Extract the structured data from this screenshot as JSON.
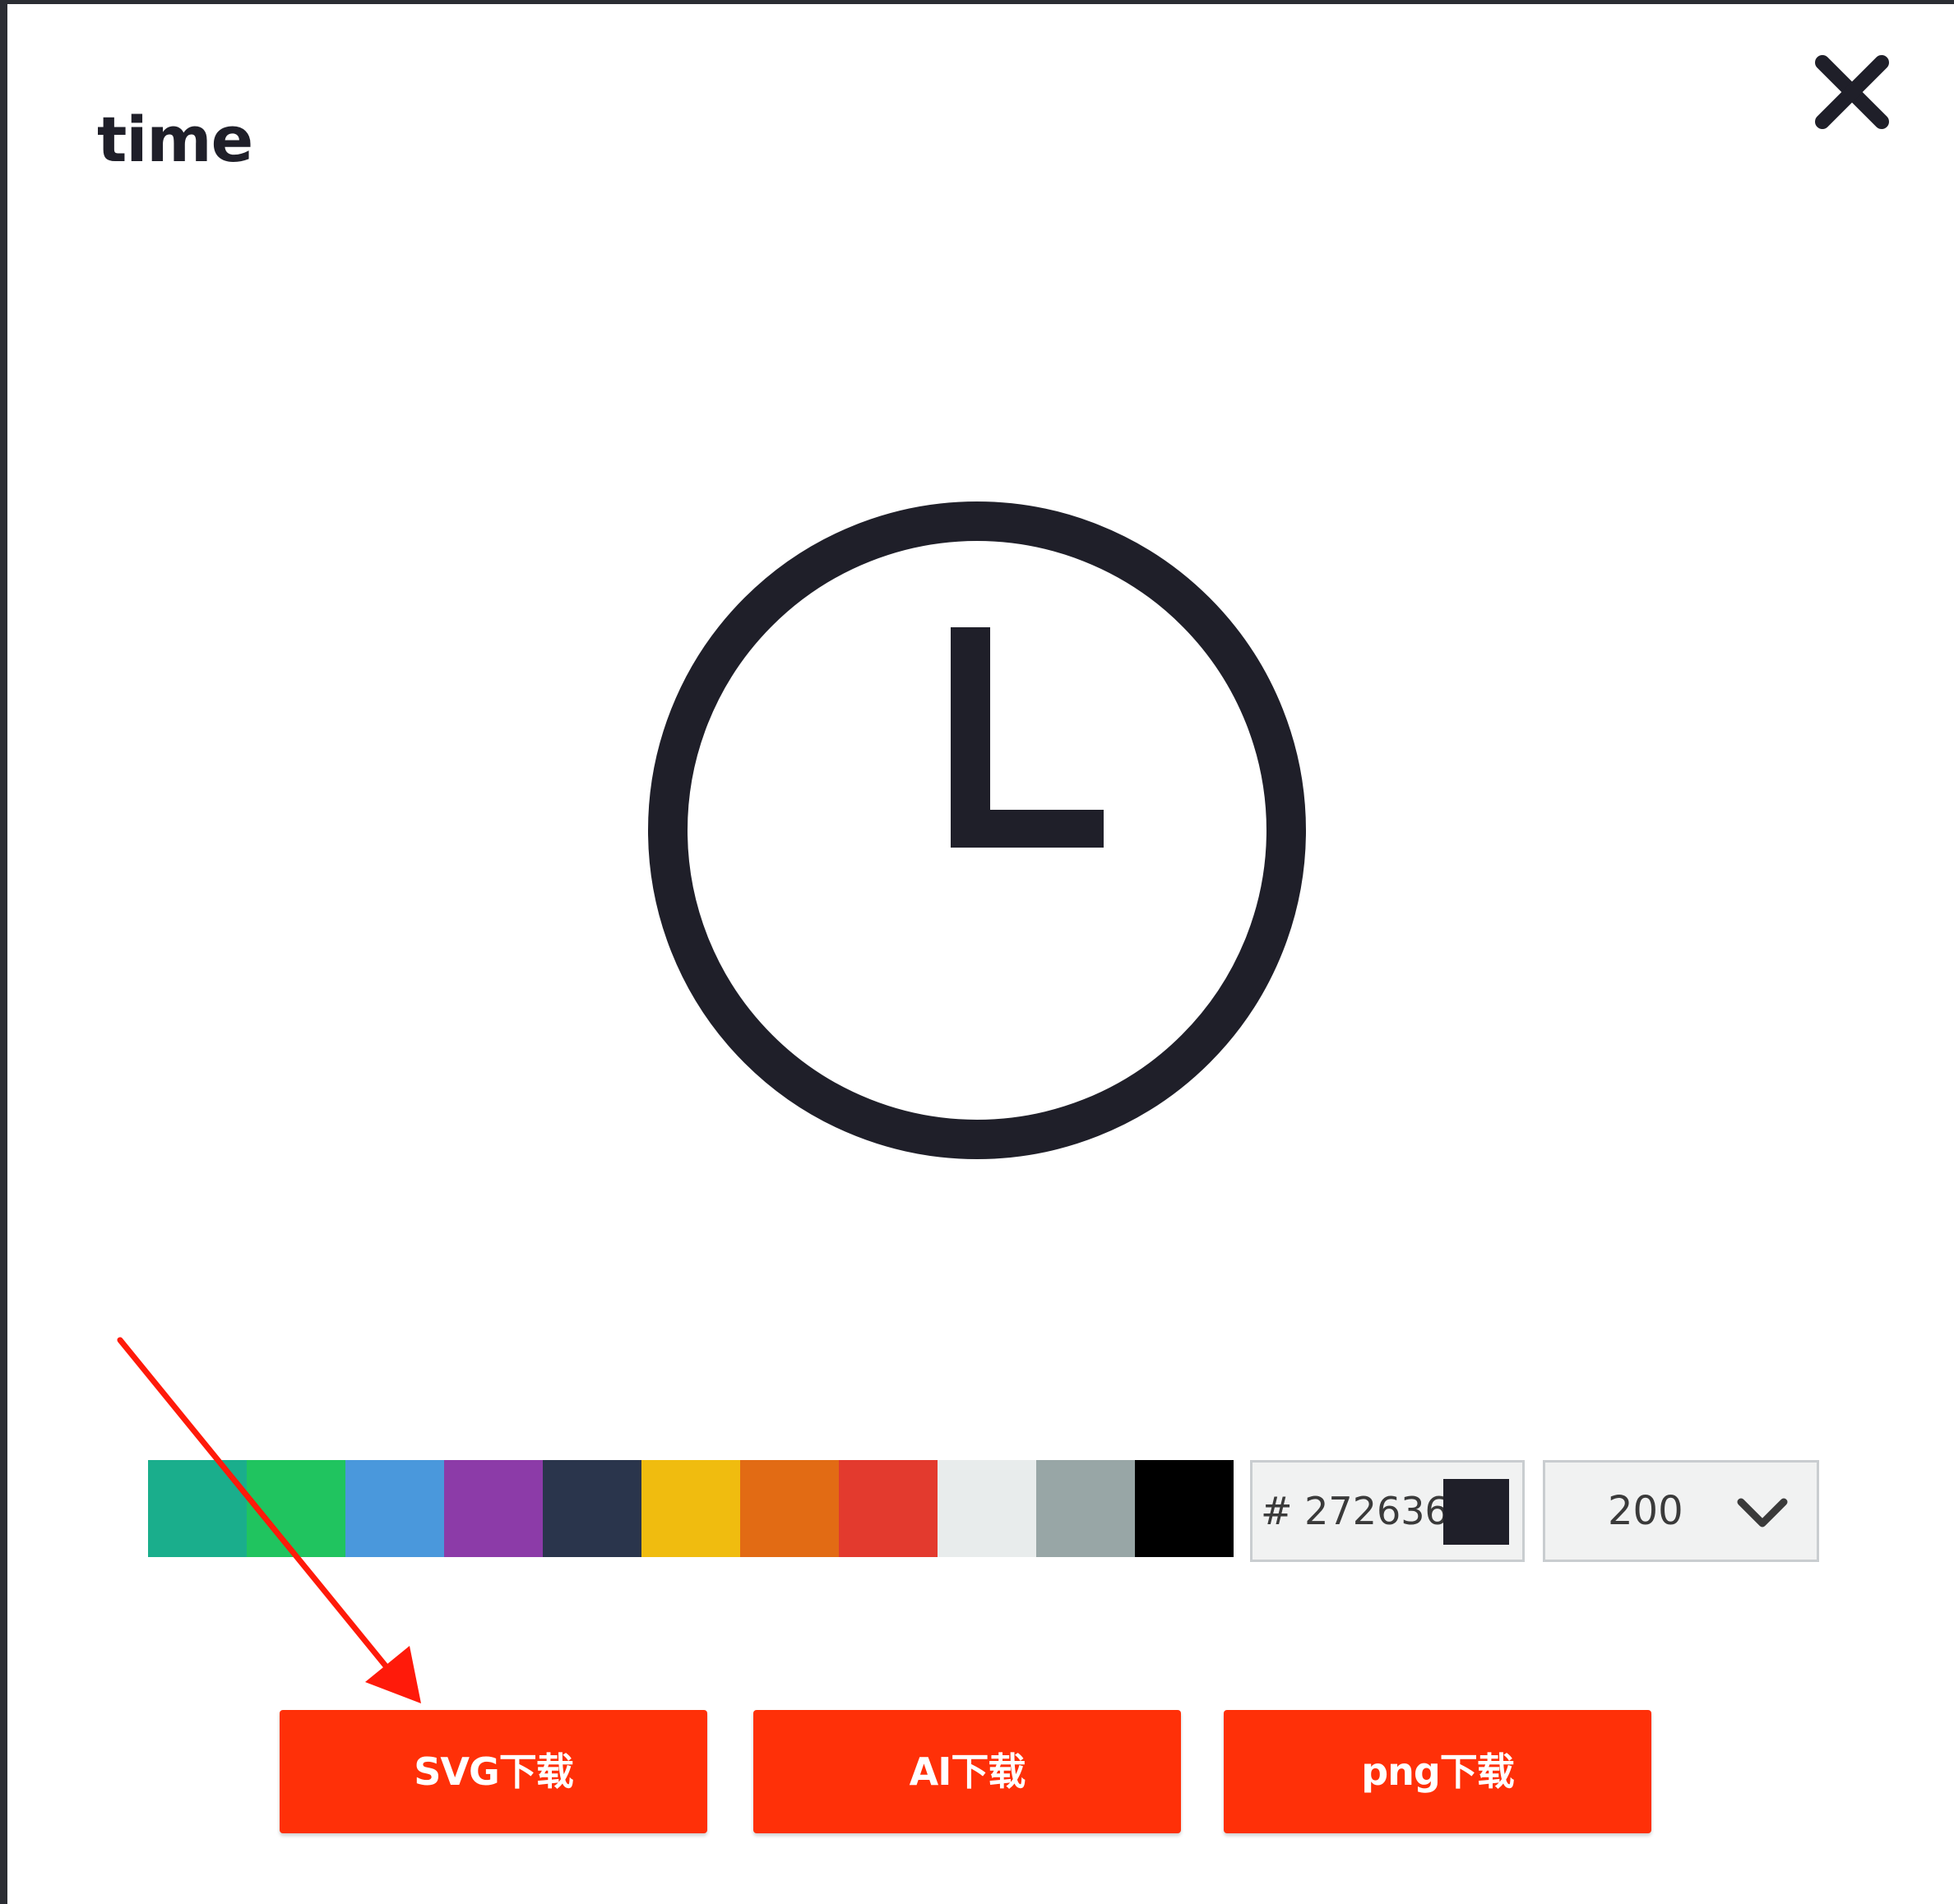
{
  "dialog": {
    "title": "time",
    "close_icon": "close-icon",
    "preview_icon": "clock-icon",
    "preview_color": "#1f1f29"
  },
  "palette": {
    "swatches": [
      {
        "name": "teal",
        "color": "#1aae8c"
      },
      {
        "name": "green",
        "color": "#20c45f"
      },
      {
        "name": "blue",
        "color": "#4a98dc"
      },
      {
        "name": "purple",
        "color": "#8c3ba8"
      },
      {
        "name": "dark-navy",
        "color": "#2a354c"
      },
      {
        "name": "yellow",
        "color": "#f0bc0f"
      },
      {
        "name": "orange",
        "color": "#e26b14"
      },
      {
        "name": "red",
        "color": "#e33a2e"
      },
      {
        "name": "light-gray",
        "color": "#e8ecec"
      },
      {
        "name": "gray",
        "color": "#98a6a6"
      },
      {
        "name": "black",
        "color": "#000000"
      }
    ],
    "hex_label": "# 272636",
    "hex_color": "#1f1f29"
  },
  "size_select": {
    "value": "200",
    "icon": "chevron-down-icon"
  },
  "buttons": {
    "svg_label": "SVG下载",
    "ai_label": "AI下载",
    "png_label": "png下载"
  },
  "annotation": {
    "icon": "red-arrow-icon",
    "color": "#ff1a0a"
  }
}
